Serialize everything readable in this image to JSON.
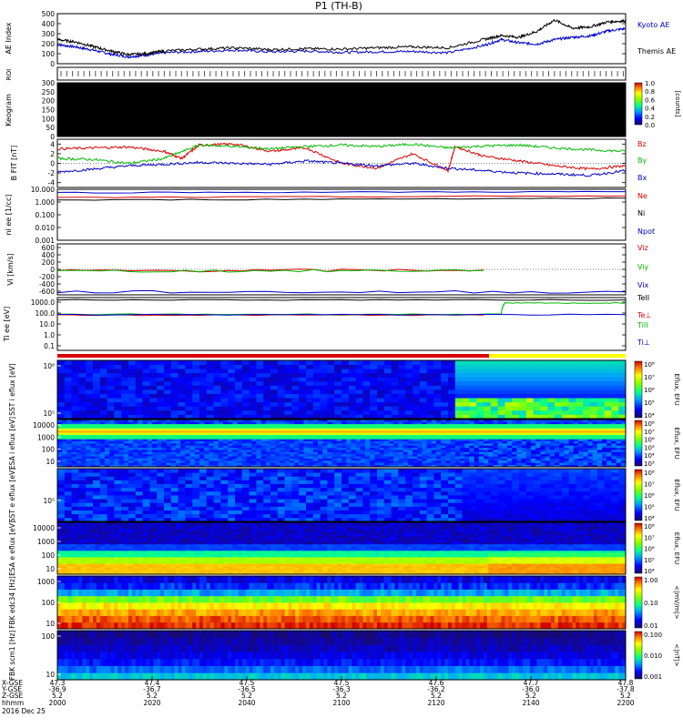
{
  "title": "P1 (TH-B)",
  "footer": {
    "row_labels": [
      "X-GSE",
      "Y-GSE",
      "Z-GSE",
      "hhmm",
      "2016 Dec 25"
    ],
    "columns": [
      {
        "x": "47.3",
        "y": "-36.9",
        "z": "5.2",
        "hhmm": "2000"
      },
      {
        "x": "47.4",
        "y": "-36.7",
        "z": "5.2",
        "hhmm": "2020"
      },
      {
        "x": "47.5",
        "y": "-36.5",
        "z": "5.2",
        "hhmm": "2040"
      },
      {
        "x": "47.5",
        "y": "-36.3",
        "z": "5.2",
        "hhmm": "2100"
      },
      {
        "x": "47.6",
        "y": "-36.2",
        "z": "5.2",
        "hhmm": "2120"
      },
      {
        "x": "47.7",
        "y": "-36.0",
        "z": "5.2",
        "hhmm": "2140"
      },
      {
        "x": "47.8",
        "y": "-37.8",
        "z": "5.2",
        "hhmm": "2200"
      }
    ]
  },
  "chart_data": [
    {
      "type": "line",
      "panel": "ae",
      "ylabel": "AE Index",
      "yticks": [
        "0",
        "100",
        "200",
        "300",
        "400",
        "500"
      ],
      "ylim": [
        0,
        550
      ],
      "series": [
        {
          "name": "Kyoto AE",
          "color": "#0000cc",
          "x": [
            2000,
            2005,
            2010,
            2015,
            2020,
            2025,
            2030,
            2040,
            2050,
            2060,
            2070,
            2080,
            2090,
            2100,
            2110,
            2120,
            2125,
            2130,
            2135,
            2140,
            2145,
            2150,
            2155,
            2160
          ],
          "y": [
            210,
            185,
            150,
            105,
            75,
            95,
            120,
            135,
            150,
            130,
            140,
            125,
            130,
            135,
            120,
            200,
            265,
            230,
            215,
            265,
            290,
            305,
            360,
            385
          ]
        },
        {
          "name": "Themis AE",
          "color": "#000000",
          "x": [
            2000,
            2005,
            2010,
            2015,
            2020,
            2025,
            2030,
            2040,
            2050,
            2060,
            2070,
            2080,
            2090,
            2100,
            2110,
            2120,
            2125,
            2130,
            2135,
            2140,
            2145,
            2150,
            2155,
            2160
          ],
          "y": [
            265,
            240,
            190,
            140,
            100,
            110,
            140,
            160,
            175,
            155,
            165,
            160,
            175,
            185,
            175,
            265,
            310,
            290,
            355,
            480,
            390,
            405,
            460,
            470
          ]
        }
      ]
    },
    {
      "type": "heatmap",
      "panel": "roi",
      "ylabel": "ROI"
    },
    {
      "type": "heatmap",
      "panel": "keogram",
      "ylabel": "Keogram",
      "yticks": [
        "0",
        "50",
        "100",
        "150",
        "200",
        "250",
        "300"
      ],
      "ylim": [
        0,
        300
      ],
      "colorbar": {
        "label": "[counts]",
        "ticks": [
          "0.0",
          "0.2",
          "0.4",
          "0.6",
          "0.8",
          "1.0"
        ]
      }
    },
    {
      "type": "line",
      "panel": "bfield",
      "ylabel": "B FIT [nT]",
      "yticks": [
        "-4",
        "-2",
        "0",
        "2",
        "4"
      ],
      "ylim": [
        -5,
        5
      ],
      "series": [
        {
          "name": "Bz",
          "color": "#dd0000",
          "x": [
            2000,
            2010,
            2020,
            2030,
            2035,
            2040,
            2050,
            2060,
            2070,
            2080,
            2090,
            2100,
            2110,
            2112,
            2120,
            2130,
            2140,
            2150,
            2160
          ],
          "y": [
            3.0,
            3.2,
            3.4,
            2.5,
            1.0,
            3.8,
            4.0,
            2.5,
            3.2,
            0.0,
            -1.0,
            2.0,
            -1.5,
            3.5,
            1.5,
            0.5,
            -0.5,
            -1.2,
            -0.5
          ]
        },
        {
          "name": "By",
          "color": "#00bb00",
          "x": [
            2000,
            2010,
            2020,
            2030,
            2040,
            2050,
            2060,
            2070,
            2080,
            2090,
            2100,
            2110,
            2120,
            2130,
            2140,
            2150,
            2160
          ],
          "y": [
            1.0,
            0.8,
            0.0,
            1.0,
            3.8,
            3.5,
            3.0,
            3.5,
            3.8,
            3.5,
            4.0,
            3.2,
            3.6,
            3.8,
            3.2,
            2.8,
            2.5
          ]
        },
        {
          "name": "Bx",
          "color": "#0000cc",
          "x": [
            2000,
            2010,
            2020,
            2030,
            2040,
            2050,
            2060,
            2070,
            2080,
            2090,
            2100,
            2110,
            2120,
            2130,
            2140,
            2150,
            2160
          ],
          "y": [
            -1.8,
            -1.2,
            -0.5,
            -0.2,
            0.2,
            0.0,
            -0.2,
            0.5,
            0.0,
            -0.5,
            0.0,
            -1.0,
            -1.5,
            -2.0,
            -2.2,
            -2.5,
            -1.5
          ]
        }
      ]
    },
    {
      "type": "line",
      "panel": "density",
      "scale": "log",
      "ylabel": "ni ee [1/cc]",
      "yticks": [
        "0.001",
        "0.010",
        "0.100",
        "1.000",
        "10.000"
      ],
      "ylim": [
        0.001,
        10
      ],
      "series": [
        {
          "name": "Ne",
          "color": "#dd0000",
          "x": [
            2000,
            2160
          ],
          "y": [
            2.2,
            3.0
          ]
        },
        {
          "name": "Ni",
          "color": "#000000",
          "x": [
            2000,
            2160
          ],
          "y": [
            1.4,
            2.0
          ]
        },
        {
          "name": "Npot",
          "color": "#0000cc",
          "x": [
            2000,
            2160
          ],
          "y": [
            5.5,
            6.5
          ]
        }
      ]
    },
    {
      "type": "line",
      "panel": "velocity",
      "ylabel": "Vi [km/s]",
      "yticks": [
        "-600",
        "-400",
        "-200",
        "0",
        "200",
        "400",
        "600"
      ],
      "ylim": [
        -700,
        700
      ],
      "series": [
        {
          "name": "Viz",
          "color": "#dd0000",
          "x": [
            2000,
            2120
          ],
          "y": [
            -40,
            -20
          ]
        },
        {
          "name": "Viy",
          "color": "#00bb00",
          "x": [
            2000,
            2120
          ],
          "y": [
            -50,
            -30
          ]
        },
        {
          "name": "Vix",
          "color": "#0000cc",
          "x": [
            2000,
            2160
          ],
          "y": [
            -620,
            -620
          ]
        }
      ]
    },
    {
      "type": "line",
      "panel": "temperature",
      "scale": "log",
      "ylabel": "Ti ee [eV]",
      "yticks": [
        "0.1",
        "1.0",
        "10.0",
        "100.0",
        "1000.0"
      ],
      "ylim": [
        0.05,
        5000
      ],
      "series": [
        {
          "name": "TeII",
          "color": "#000000",
          "x": [
            2000,
            2160
          ],
          "y": [
            3000,
            3000
          ]
        },
        {
          "name": "Te⊥",
          "color": "#dd0000",
          "x": [
            2000,
            2120
          ],
          "y": [
            110,
            110
          ]
        },
        {
          "name": "TiII",
          "color": "#00bb00",
          "x": [
            2000,
            2125,
            2126,
            2160
          ],
          "y": [
            130,
            130,
            1500,
            1500
          ]
        },
        {
          "name": "Ti⊥",
          "color": "#0000cc",
          "x": [
            2000,
            2160
          ],
          "y": [
            120,
            120
          ]
        }
      ]
    },
    {
      "type": "heatmap",
      "panel": "mode_bar"
    },
    {
      "type": "heatmap",
      "panel": "sst_ion",
      "ylabel": "SST i eflux [eV]",
      "yticks": [
        "10⁵",
        "10⁶"
      ],
      "colorbar": {
        "label": "Eflux, EFU",
        "ticks": [
          "10⁴",
          "10⁵",
          "10⁶",
          "10⁷",
          "10⁸"
        ]
      }
    },
    {
      "type": "heatmap",
      "panel": "esa_ion",
      "ylabel": "ESA i eflux [eV]",
      "yticks": [
        "10",
        "100",
        "1000",
        "10000"
      ],
      "colorbar": {
        "label": "Eflux, EFU",
        "ticks": [
          "10³",
          "10⁴",
          "10⁵",
          "10⁶",
          "10⁷",
          "10⁸"
        ]
      }
    },
    {
      "type": "heatmap",
      "panel": "sst_elec",
      "ylabel": "SST e eflux [eV]",
      "yticks": [
        "10⁵"
      ],
      "colorbar": {
        "label": "Eflux, EFU",
        "ticks": [
          "10⁴",
          "10⁵",
          "10⁶",
          "10⁷",
          "10⁸"
        ]
      }
    },
    {
      "type": "heatmap",
      "panel": "esa_elec",
      "ylabel": "ESA e eflux [eV]",
      "yticks": [
        "10",
        "100",
        "1000",
        "10000"
      ],
      "colorbar": {
        "label": "Eflux, EFU",
        "ticks": [
          "10⁴",
          "10⁵",
          "10⁶",
          "10⁷",
          "10⁸"
        ]
      }
    },
    {
      "type": "heatmap",
      "panel": "fbk_e",
      "ylabel": "FBK edc34 [Hz]",
      "yticks": [
        "10",
        "100",
        "1000"
      ],
      "colorbar": {
        "label": "<|mV/m|>",
        "ticks": [
          "0.01",
          "0.10",
          "1.00"
        ]
      }
    },
    {
      "type": "heatmap",
      "panel": "fbk_b",
      "ylabel": "FBK scm1 [Hz]",
      "yticks": [
        "10",
        "100"
      ],
      "colorbar": {
        "label": "<|nT|>",
        "ticks": [
          "0.001",
          "0.010",
          "0.100"
        ]
      }
    }
  ]
}
